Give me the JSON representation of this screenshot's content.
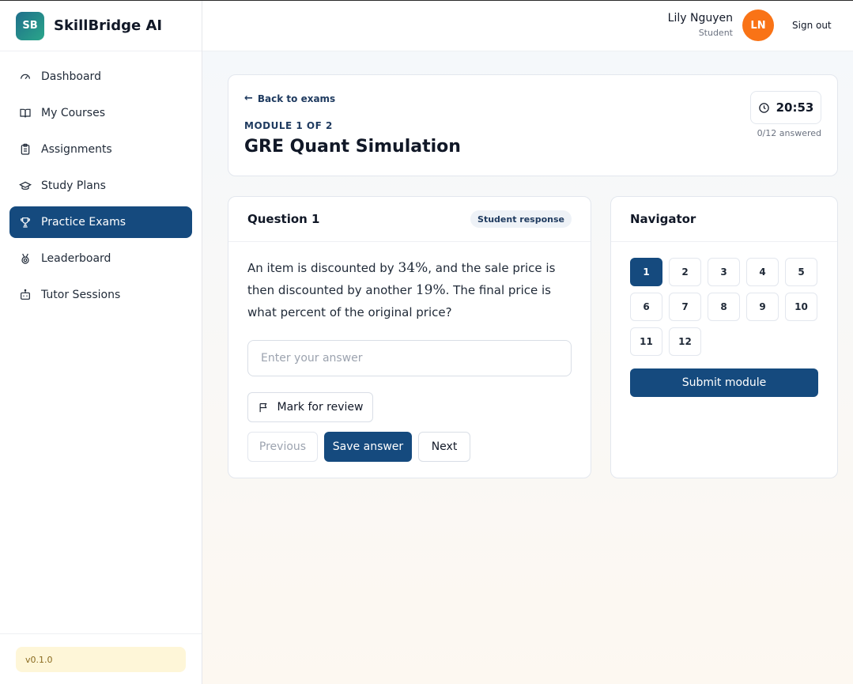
{
  "brand": {
    "logo": "SB",
    "name": "SkillBridge AI"
  },
  "sidebar": {
    "items": [
      {
        "label": "Dashboard",
        "icon": "gauge-icon",
        "active": false
      },
      {
        "label": "My Courses",
        "icon": "book-icon",
        "active": false
      },
      {
        "label": "Assignments",
        "icon": "clipboard-icon",
        "active": false
      },
      {
        "label": "Study Plans",
        "icon": "graduation-cap-icon",
        "active": false
      },
      {
        "label": "Practice Exams",
        "icon": "trophy-icon",
        "active": true
      },
      {
        "label": "Leaderboard",
        "icon": "medal-icon",
        "active": false
      },
      {
        "label": "Tutor Sessions",
        "icon": "bot-icon",
        "active": false
      }
    ],
    "version": "v0.1.0"
  },
  "header": {
    "user_name": "Lily Nguyen",
    "user_role": "Student",
    "avatar_initials": "LN",
    "avatar_color": "#f97316",
    "sign_out": "Sign out"
  },
  "exam": {
    "back_label": "Back to exams",
    "module_label": "MODULE 1 OF 2",
    "title": "GRE Quant Simulation",
    "timer": "20:53",
    "answered": "0/12 answered"
  },
  "question": {
    "title": "Question 1",
    "badge": "Student response",
    "text_1": "An item is discounted by ",
    "math_1": "34%",
    "text_2": ", and the sale price is then discounted by another ",
    "math_2": "19%",
    "text_3": ". The final price is what percent of the original price?",
    "input_placeholder": "Enter your answer",
    "input_value": "",
    "review_label": "Mark for review",
    "prev_label": "Previous",
    "save_label": "Save answer",
    "next_label": "Next"
  },
  "navigator": {
    "title": "Navigator",
    "questions": [
      "1",
      "2",
      "3",
      "4",
      "5",
      "6",
      "7",
      "8",
      "9",
      "10",
      "11",
      "12"
    ],
    "current": "1",
    "submit_label": "Submit module"
  },
  "colors": {
    "primary": "#154a7e",
    "accent": "#f97316"
  }
}
